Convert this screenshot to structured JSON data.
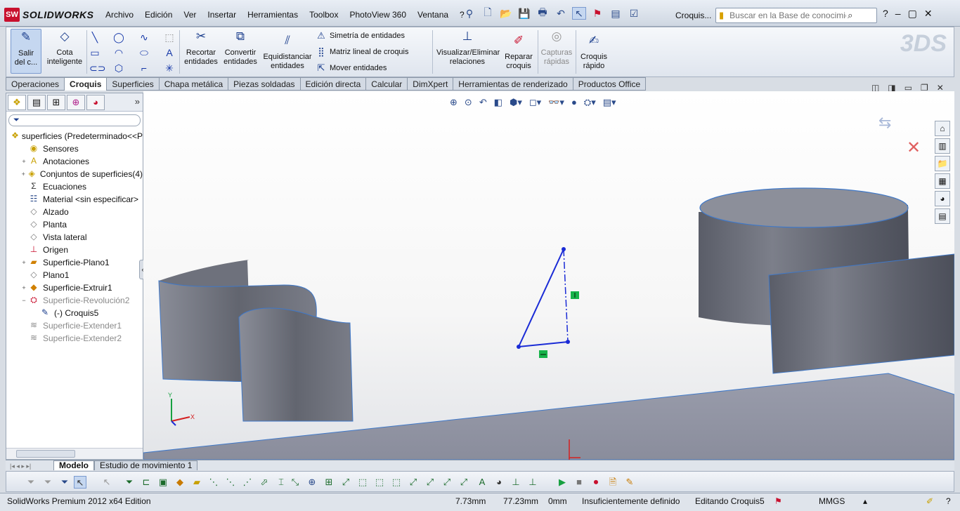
{
  "app": {
    "logo_badge": "SW",
    "logo_name": "SOLIDWORKS",
    "doc_title": "Croquis...",
    "brand_color": "#c8102e"
  },
  "menu": [
    "Archivo",
    "Edición",
    "Ver",
    "Insertar",
    "Herramientas",
    "Toolbox",
    "PhotoView 360",
    "Ventana",
    "?"
  ],
  "search": {
    "placeholder": "Buscar en la Base de conocimiento"
  },
  "commands": {
    "exit_sketch": "Salir\ndel c...",
    "smart_dim": "Cota\ninteligente",
    "trim": "Recortar\nentidades",
    "convert": "Convertir\nentidades",
    "offset": "Equidistanciar\nentidades",
    "mirror": "Simetría de entidades",
    "linear_pattern": "Matriz lineal de croquis",
    "move": "Mover entidades",
    "relations": "Visualizar/Eliminar\nrelaciones",
    "repair": "Reparar\ncroquis",
    "snaps": "Capturas\nrápidas",
    "rapid": "Croquis\nrápido"
  },
  "tabs": [
    "Operaciones",
    "Croquis",
    "Superficies",
    "Chapa metálica",
    "Piezas soldadas",
    "Edición directa",
    "Calcular",
    "DimXpert",
    "Herramientas de renderizado",
    "Productos Office"
  ],
  "active_tab": "Croquis",
  "tree": [
    {
      "label": "superficies  (Predeterminado<<P",
      "icon": "part-icon",
      "exp": "",
      "indent": 0,
      "dim": false
    },
    {
      "label": "Sensores",
      "icon": "sensor-icon",
      "exp": "",
      "indent": 1,
      "dim": false
    },
    {
      "label": "Anotaciones",
      "icon": "annotation-icon",
      "exp": "+",
      "indent": 1,
      "dim": false
    },
    {
      "label": "Conjuntos de superficies(4)",
      "icon": "surface-bodies-icon",
      "exp": "+",
      "indent": 1,
      "dim": false
    },
    {
      "label": "Ecuaciones",
      "icon": "equation-icon",
      "exp": "",
      "indent": 1,
      "dim": false
    },
    {
      "label": "Material <sin especificar>",
      "icon": "material-icon",
      "exp": "",
      "indent": 1,
      "dim": false
    },
    {
      "label": "Alzado",
      "icon": "plane-icon",
      "exp": "",
      "indent": 1,
      "dim": false
    },
    {
      "label": "Planta",
      "icon": "plane-icon",
      "exp": "",
      "indent": 1,
      "dim": false
    },
    {
      "label": "Vista lateral",
      "icon": "plane-icon",
      "exp": "",
      "indent": 1,
      "dim": false
    },
    {
      "label": "Origen",
      "icon": "origin-icon",
      "exp": "",
      "indent": 1,
      "dim": false
    },
    {
      "label": "Superficie-Plano1",
      "icon": "surface-plane-icon",
      "exp": "+",
      "indent": 1,
      "dim": false
    },
    {
      "label": "Plano1",
      "icon": "plane-icon",
      "exp": "",
      "indent": 1,
      "dim": false
    },
    {
      "label": "Superficie-Extruir1",
      "icon": "surface-extrude-icon",
      "exp": "+",
      "indent": 1,
      "dim": false
    },
    {
      "label": "Superficie-Revolución2",
      "icon": "surface-revolve-icon",
      "exp": "−",
      "indent": 1,
      "dim": true
    },
    {
      "label": "(-) Croquis5",
      "icon": "sketch-icon",
      "exp": "",
      "indent": 2,
      "dim": false
    },
    {
      "label": "Superficie-Extender1",
      "icon": "surface-extend-icon",
      "exp": "",
      "indent": 1,
      "dim": true
    },
    {
      "label": "Superficie-Extender2",
      "icon": "surface-extend-icon",
      "exp": "",
      "indent": 1,
      "dim": true
    }
  ],
  "bottom_tabs": [
    "Modelo",
    "Estudio de movimiento 1"
  ],
  "status": {
    "edition": "SolidWorks Premium 2012 x64 Edition",
    "x": "7.73mm",
    "y": "77.23mm",
    "z": "0mm",
    "defined": "Insuficientemente definido",
    "editing": "Editando Croquis5",
    "units": "MMGS"
  },
  "colors": {
    "sketch": "#1a2bd6",
    "surface": "#6b6e79",
    "relation": "#17b34a",
    "selected": "#c5d7f0"
  }
}
